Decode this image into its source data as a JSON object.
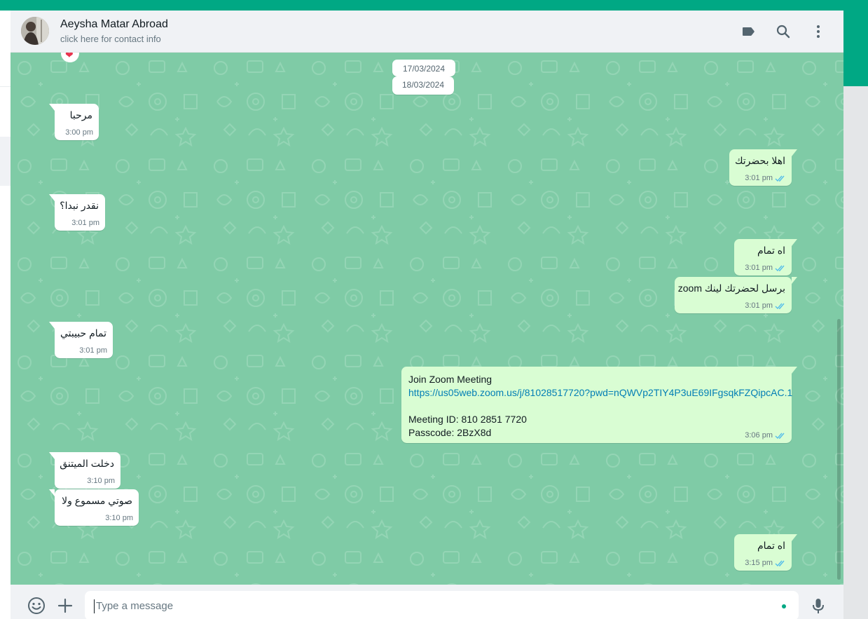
{
  "colors": {
    "accent": "#00a884",
    "chat_background": "#7fcba6",
    "incoming_bubble": "#ffffff",
    "outgoing_bubble": "#d9fdd3",
    "read_ticks": "#53bdeb",
    "link": "#027eb5"
  },
  "header": {
    "contact_name": "Aeysha Matar Abroad",
    "contact_subtitle": "click here for contact info",
    "icons": [
      "label-icon",
      "search-icon",
      "menu-icon"
    ]
  },
  "chat": {
    "reaction": "❤",
    "dates": [
      "17/03/2024",
      "18/03/2024"
    ],
    "messages": [
      {
        "direction": "in",
        "text": "مرحبا",
        "time": "3:00 pm"
      },
      {
        "direction": "out",
        "text": "اهلا بحضرتك",
        "time": "3:01 pm",
        "status": "read"
      },
      {
        "direction": "in",
        "text": "نقدر نبدا؟",
        "time": "3:01 pm"
      },
      {
        "direction": "out",
        "text": "اه تمام",
        "time": "3:01 pm",
        "status": "read"
      },
      {
        "direction": "out",
        "text": "برسل لحضرتك لينك zoom",
        "time": "3:01 pm",
        "status": "read"
      },
      {
        "direction": "in",
        "text": "تمام حبيبتي",
        "time": "3:01 pm"
      },
      {
        "direction": "out",
        "lines": [
          "Join Zoom Meeting",
          "https://us05web.zoom.us/j/81028517720?pwd=nQWVp2TIY4P3uE69IFgsqkFZQipcAC.1",
          "Meeting ID: 810 2851 7720",
          "Passcode: 2BzX8d"
        ],
        "time": "3:06 pm",
        "status": "read"
      },
      {
        "direction": "in",
        "text": "دخلت الميتنق",
        "time": "3:10 pm"
      },
      {
        "direction": "in",
        "text": "صوتي مسموع ولا",
        "time": "3:10 pm"
      },
      {
        "direction": "out",
        "text": "اه تمام",
        "time": "3:15 pm",
        "status": "read"
      }
    ]
  },
  "footer": {
    "placeholder": "Type a message",
    "icons": [
      "emoji-icon",
      "attach-plus-icon",
      "microphone-icon"
    ]
  }
}
